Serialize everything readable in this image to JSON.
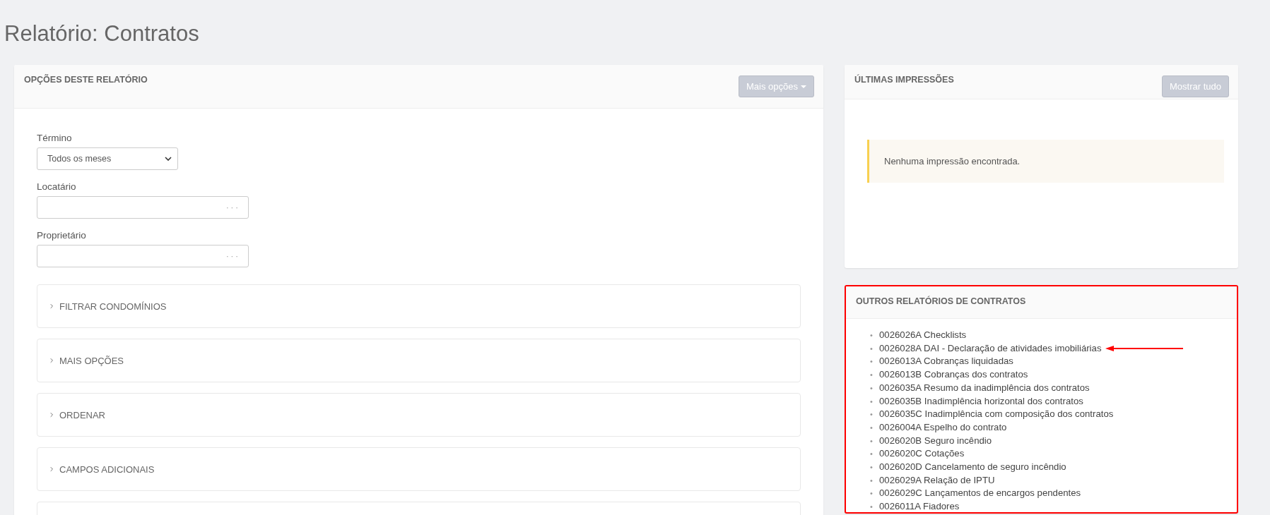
{
  "page_title": "Relatório: Contratos",
  "options_panel": {
    "title": "OPÇÕES DESTE RELATÓRIO",
    "button": "Mais opções",
    "fields": [
      {
        "kind": "select",
        "label": "Término",
        "value": "Todos os meses"
      },
      {
        "kind": "lookup",
        "label": "Locatário",
        "button": "· · ·"
      },
      {
        "kind": "lookup",
        "label": "Proprietário",
        "button": "· · ·"
      }
    ],
    "sections": [
      {
        "label": "FILTRAR CONDOMÍNIOS",
        "expanded": false
      },
      {
        "label": "MAIS OPÇÕES",
        "expanded": false
      },
      {
        "label": "ORDENAR",
        "expanded": false
      },
      {
        "label": "CAMPOS ADICIONAIS",
        "expanded": false
      }
    ],
    "section_cut_off_below": true
  },
  "prints_panel": {
    "title": "ÚLTIMAS IMPRESSÕES",
    "button": "Mostrar tudo",
    "message": "Nenhuma impressão encontrada."
  },
  "other_reports_panel": {
    "title": "OUTROS RELATÓRIOS DE CONTRATOS",
    "highlighted": true,
    "marker": "•",
    "items": [
      {
        "label": "0026026A Checklists",
        "arrow": false
      },
      {
        "label": "0026028A DAI - Declaração de atividades imobiliárias",
        "arrow": true
      },
      {
        "label": "0026013A Cobranças liquidadas",
        "arrow": false
      },
      {
        "label": "0026013B Cobranças dos contratos",
        "arrow": false
      },
      {
        "label": "0026035A Resumo da inadimplência dos contratos",
        "arrow": false
      },
      {
        "label": "0026035B Inadimplência horizontal dos contratos",
        "arrow": false
      },
      {
        "label": "0026035C Inadimplência com composição dos contratos",
        "arrow": false
      },
      {
        "label": "0026004A Espelho do contrato",
        "arrow": false
      },
      {
        "label": "0026020B Seguro incêndio",
        "arrow": false
      },
      {
        "label": "0026020C Cotações",
        "arrow": false
      },
      {
        "label": "0026020D Cancelamento de seguro incêndio",
        "arrow": false
      },
      {
        "label": "0026029A Relação de IPTU",
        "arrow": false
      },
      {
        "label": "0026029C Lançamentos de encargos pendentes",
        "arrow": false
      },
      {
        "label": "0026011A Fiadores",
        "arrow": false
      }
    ]
  }
}
